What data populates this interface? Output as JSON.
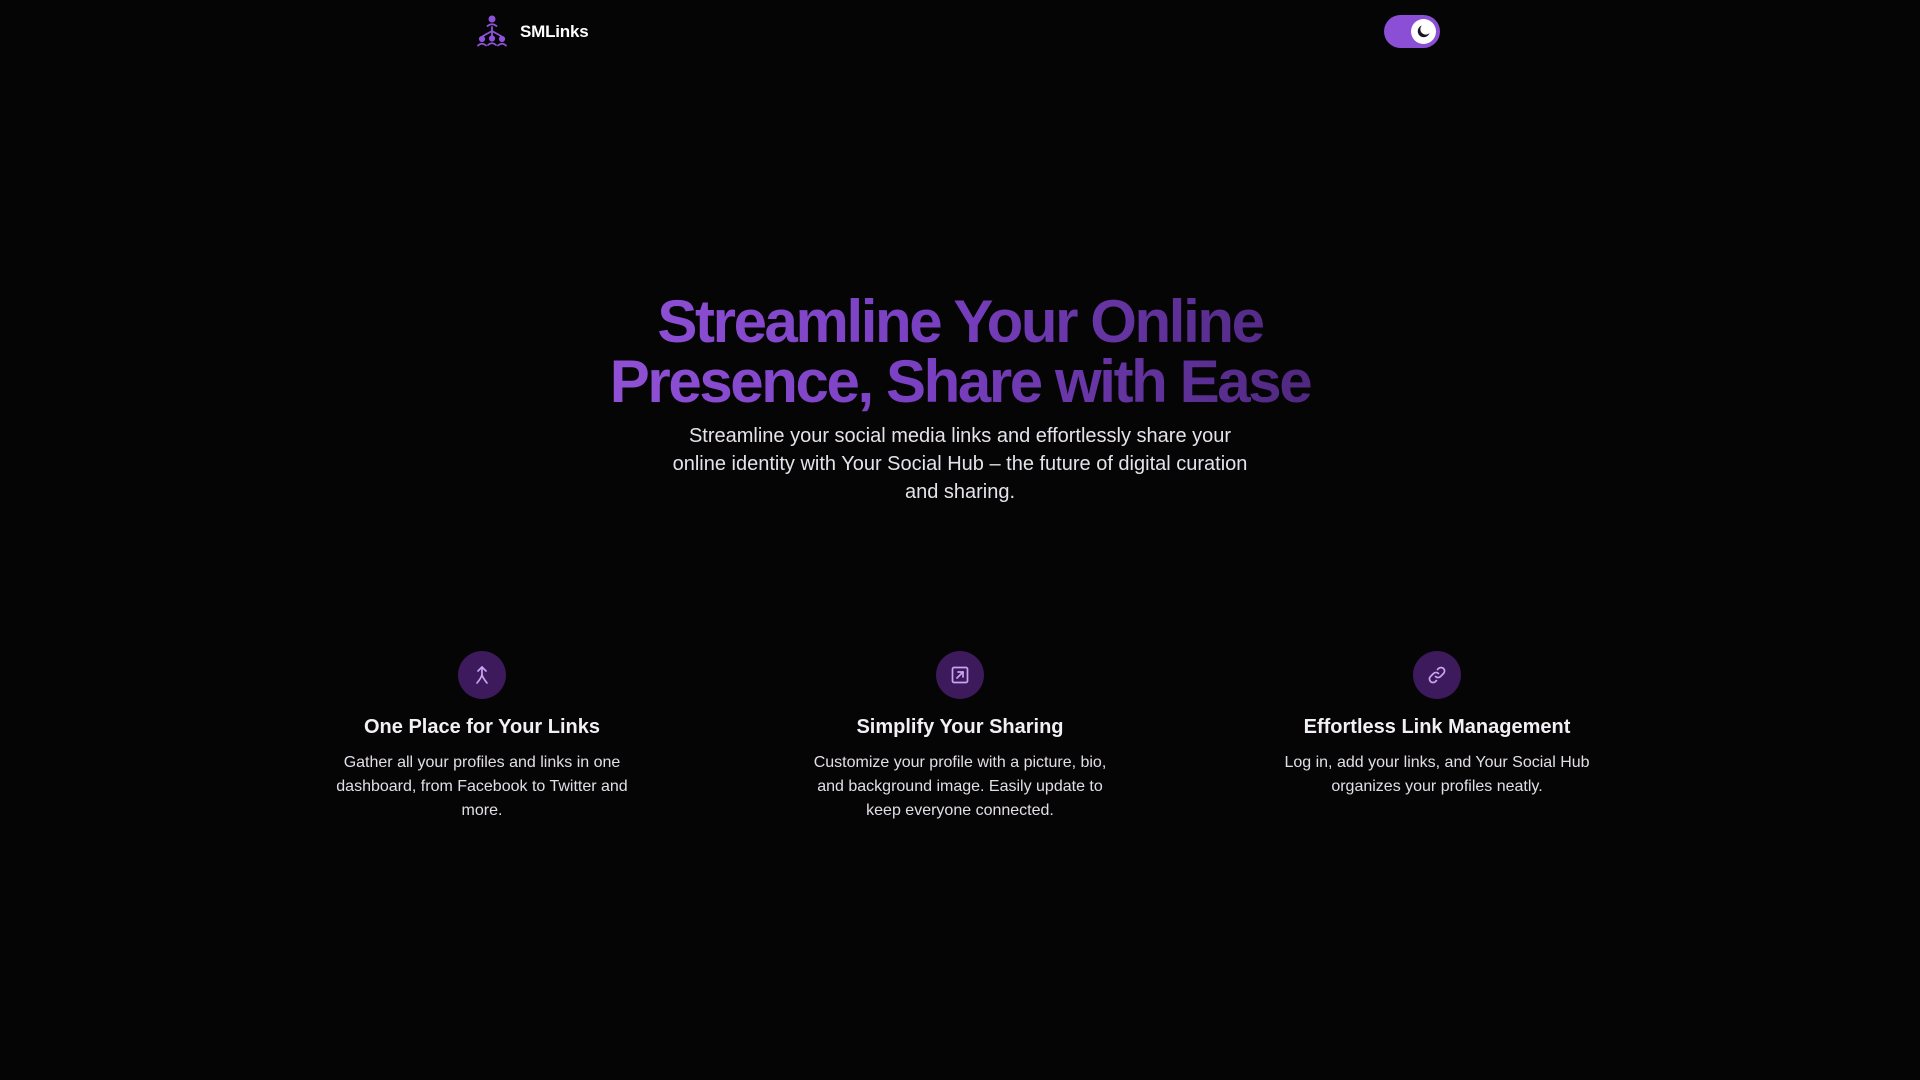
{
  "header": {
    "brand_name": "SMLinks",
    "logo_icon": "network-nodes-icon",
    "theme_toggle_icon": "moon-icon"
  },
  "hero": {
    "title_line1": "Streamline Your Online",
    "title_line2": "Presence, Share with Ease",
    "subtitle": "Streamline your social media links and effortlessly share your online identity with Your Social Hub – the future of digital curation and sharing."
  },
  "features": [
    {
      "icon": "merge-arrows-icon",
      "title": "One Place for Your Links",
      "text": "Gather all your profiles and links in one dashboard, from Facebook to Twitter and more."
    },
    {
      "icon": "external-link-square-icon",
      "title": "Simplify Your Sharing",
      "text": "Customize your profile with a picture, bio, and background image. Easily update to keep everyone connected."
    },
    {
      "icon": "link-chain-icon",
      "title": "Effortless Link Management",
      "text": "Log in, add your links, and Your Social Hub organizes your profiles neatly."
    }
  ],
  "colors": {
    "background": "#060506",
    "accent": "#8b4fd6",
    "icon_circle": "#3c1a5c",
    "gradient_start": "#9353d8",
    "gradient_end": "#4a2578"
  }
}
